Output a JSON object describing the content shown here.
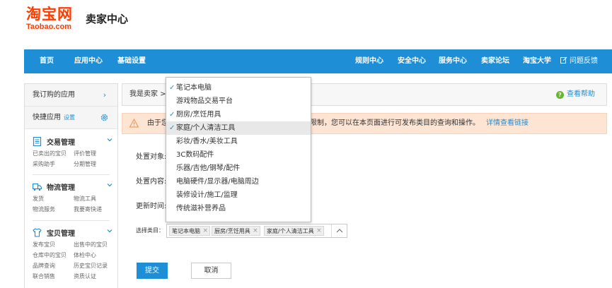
{
  "logo": {
    "cn": "淘宝网",
    "en": "Taobao.com",
    "sub": "卖家中心"
  },
  "nav": {
    "left": [
      "首页",
      "应用中心",
      "基础设置"
    ],
    "right": [
      "规则中心",
      "安全中心",
      "服务中心",
      "卖家论坛",
      "淘宝大学"
    ],
    "feedback": "问题反馈"
  },
  "sidebar": {
    "my_apps": "我订购的应用",
    "quick_apps": "快捷应用",
    "quick_setting": "设置",
    "sections": [
      {
        "title": "交易管理",
        "icon": "trade-icon",
        "links": [
          "已卖出的宝贝",
          "评价管理",
          "采购助手",
          "分期管理"
        ]
      },
      {
        "title": "物流管理",
        "icon": "logistics-icon",
        "links": [
          "发货",
          "物流工具",
          "物流服务",
          "我要寄快递"
        ]
      },
      {
        "title": "宝贝管理",
        "icon": "goods-icon",
        "links": [
          "发布宝贝",
          "出售中的宝贝",
          "仓库中的宝贝",
          "体检中心",
          "品牌查询",
          "历史宝贝记录",
          "联合销售",
          "资质认证"
        ]
      }
    ]
  },
  "main": {
    "breadcrumb": "我是卖家 > ",
    "help": "查看帮助",
    "notice": {
      "text_a": "由于您",
      "text_b": "限制，您可以在本页面进行可发布类目的查询和操作。",
      "link": "详情查看链接"
    },
    "fields": {
      "target": "处置对象:",
      "content": "处置内容:",
      "updated": "更新时间:"
    },
    "category_label": "选择类目：",
    "selected_tags": [
      "笔记本电脑",
      "厨房/烹饪用具",
      "家庭/个人清洁工具"
    ],
    "submit": "提交",
    "cancel": "取消"
  },
  "dropdown": {
    "items": [
      {
        "label": "笔记本电脑",
        "checked": true
      },
      {
        "label": "游戏物品交易平台",
        "checked": false
      },
      {
        "label": "厨房/烹饪用具",
        "checked": true
      },
      {
        "label": "家庭/个人清洁工具",
        "checked": true
      },
      {
        "label": "彩妆/香水/美妆工具",
        "checked": false
      },
      {
        "label": "3C数码配件",
        "checked": false
      },
      {
        "label": "乐器/吉他/钢琴/配件",
        "checked": false
      },
      {
        "label": "电脑硬件/显示器/电脑周边",
        "checked": false
      },
      {
        "label": "装修设计/施工/监理",
        "checked": false
      },
      {
        "label": "传统滋补营养品",
        "checked": false
      }
    ],
    "highlighted_index": 3
  },
  "colors": {
    "brand_orange": "#ff3c00",
    "nav_blue": "#1e8ed6",
    "notice_bg": "#fde4d3"
  }
}
